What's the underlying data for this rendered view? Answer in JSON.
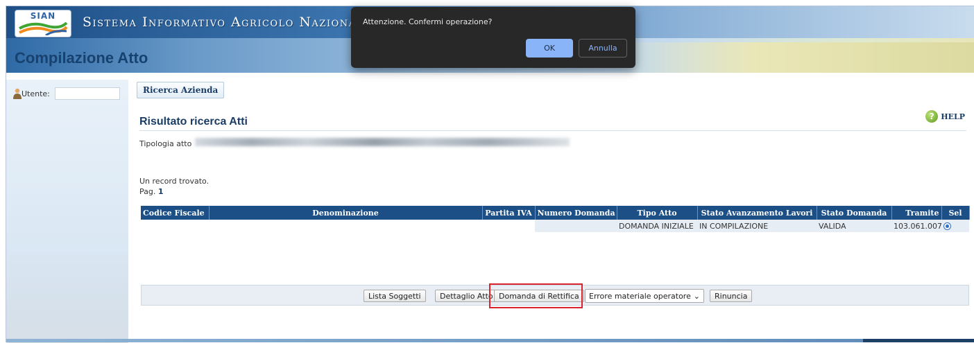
{
  "header": {
    "logo_text": "SIAN",
    "site_title": "Sistema Informativo Agricolo Nazional",
    "page_title": "Compilazione Atto"
  },
  "sidebar": {
    "user_label": "Utente:",
    "user_value": ""
  },
  "content": {
    "search_button": "Ricerca Azienda",
    "section_title": "Risultato ricerca Atti",
    "help_label": "HELP",
    "tipologia_label": "Tipologia atto",
    "record_count": "Un record trovato.",
    "page_label": "Pag.",
    "page_number": "1"
  },
  "table": {
    "columns": [
      "Codice Fiscale",
      "Denominazione",
      "Partita IVA",
      "Numero Domanda",
      "Tipo Atto",
      "Stato Avanzamento Lavori",
      "Stato Domanda",
      "Tramite",
      "Sel"
    ],
    "rows": [
      {
        "codice_fiscale": "",
        "denominazione": "",
        "partita_iva": "",
        "numero_domanda": "",
        "tipo_atto": "DOMANDA INIZIALE",
        "stato_avanzamento": "IN COMPILAZIONE",
        "stato_domanda": "VALIDA",
        "tramite": "103.061.007",
        "selected": true
      }
    ]
  },
  "actions": {
    "lista_soggetti": "Lista Soggetti",
    "dettaglio_atto": "Dettaglio Atto",
    "domanda_rettifica": "Domanda di Rettifica",
    "errore_select_value": "Errore materiale operatore",
    "rinuncia": "Rinuncia"
  },
  "dialog": {
    "message": "Attenzione. Confermi operazione?",
    "ok_label": "OK",
    "cancel_label": "Annulla"
  },
  "colors": {
    "header_blue": "#1b4f85",
    "highlight_red": "#d9232f",
    "dialog_bg": "#282828",
    "dialog_accent": "#8ab4f8"
  }
}
